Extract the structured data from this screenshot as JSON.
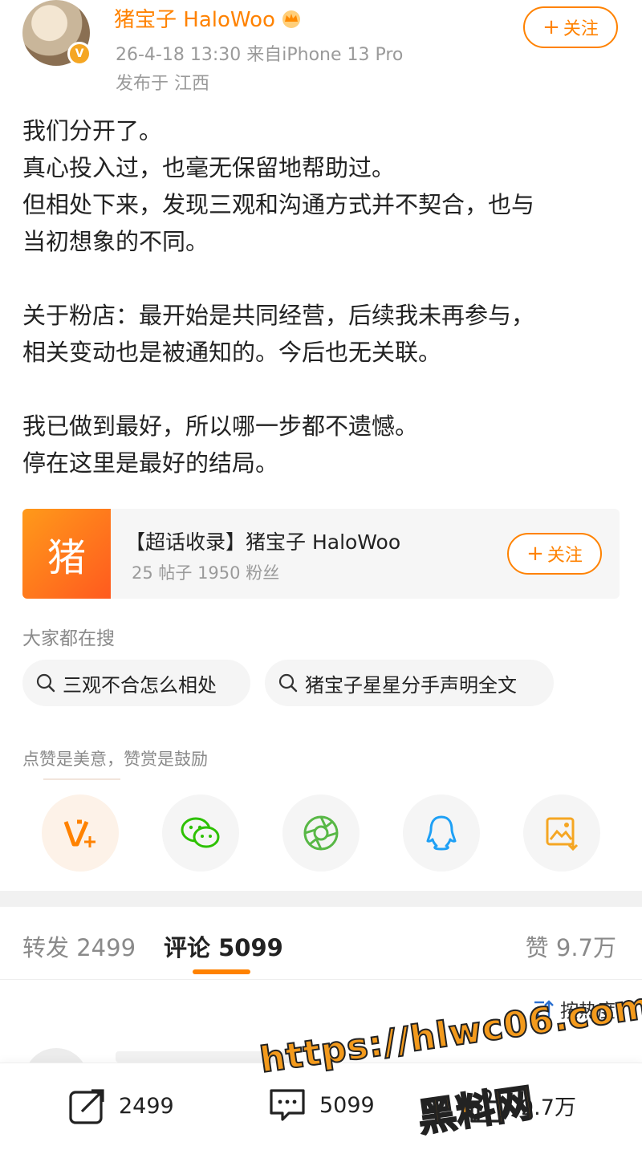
{
  "header": {
    "username": "猪宝子 HaloWoo",
    "meta": "26-4-18 13:30  来自iPhone 13 Pro",
    "location": "发布于 江西",
    "follow_label": "关注"
  },
  "post": {
    "paragraphs": [
      [
        "我们分开了。",
        "真心投入过，也毫无保留地帮助过。",
        "但相处下来，发现三观和沟通方式并不契合，也与",
        "当初想象的不同。"
      ],
      [
        "关于粉店：最开始是共同经营，后续我未再参与，",
        "相关变动也是被通知的。今后也无关联。"
      ],
      [
        "我已做到最好，所以哪一步都不遗憾。",
        "停在这里是最好的结局。"
      ]
    ]
  },
  "topic_card": {
    "thumb_char": "猪",
    "title": "【超话收录】猪宝子 HaloWoo",
    "subtitle": "25 帖子 1950 粉丝",
    "follow_label": "关注"
  },
  "search": {
    "heading": "大家都在搜",
    "chips": [
      "三观不合怎么相处",
      "猪宝子星星分手声明全文"
    ]
  },
  "like_prompt": "点赞是美意，赞赏是鼓励",
  "share_icons": [
    "vplus-icon",
    "wechat-icon",
    "moments-icon",
    "qq-icon",
    "save-image-icon"
  ],
  "tabs": {
    "repost": "转发 2499",
    "comment": "评论 5099",
    "like": "赞 9.7万"
  },
  "sort_label": "按热度",
  "bottom_bar": {
    "repost_count": "2499",
    "comment_count": "5099",
    "like_count": "9.7万"
  },
  "watermark": {
    "url": "https://hlwc06.com",
    "name": "黑料网"
  },
  "colors": {
    "accent": "#ff8200",
    "wechat": "#2dc100",
    "qq": "#1ea0f5"
  }
}
